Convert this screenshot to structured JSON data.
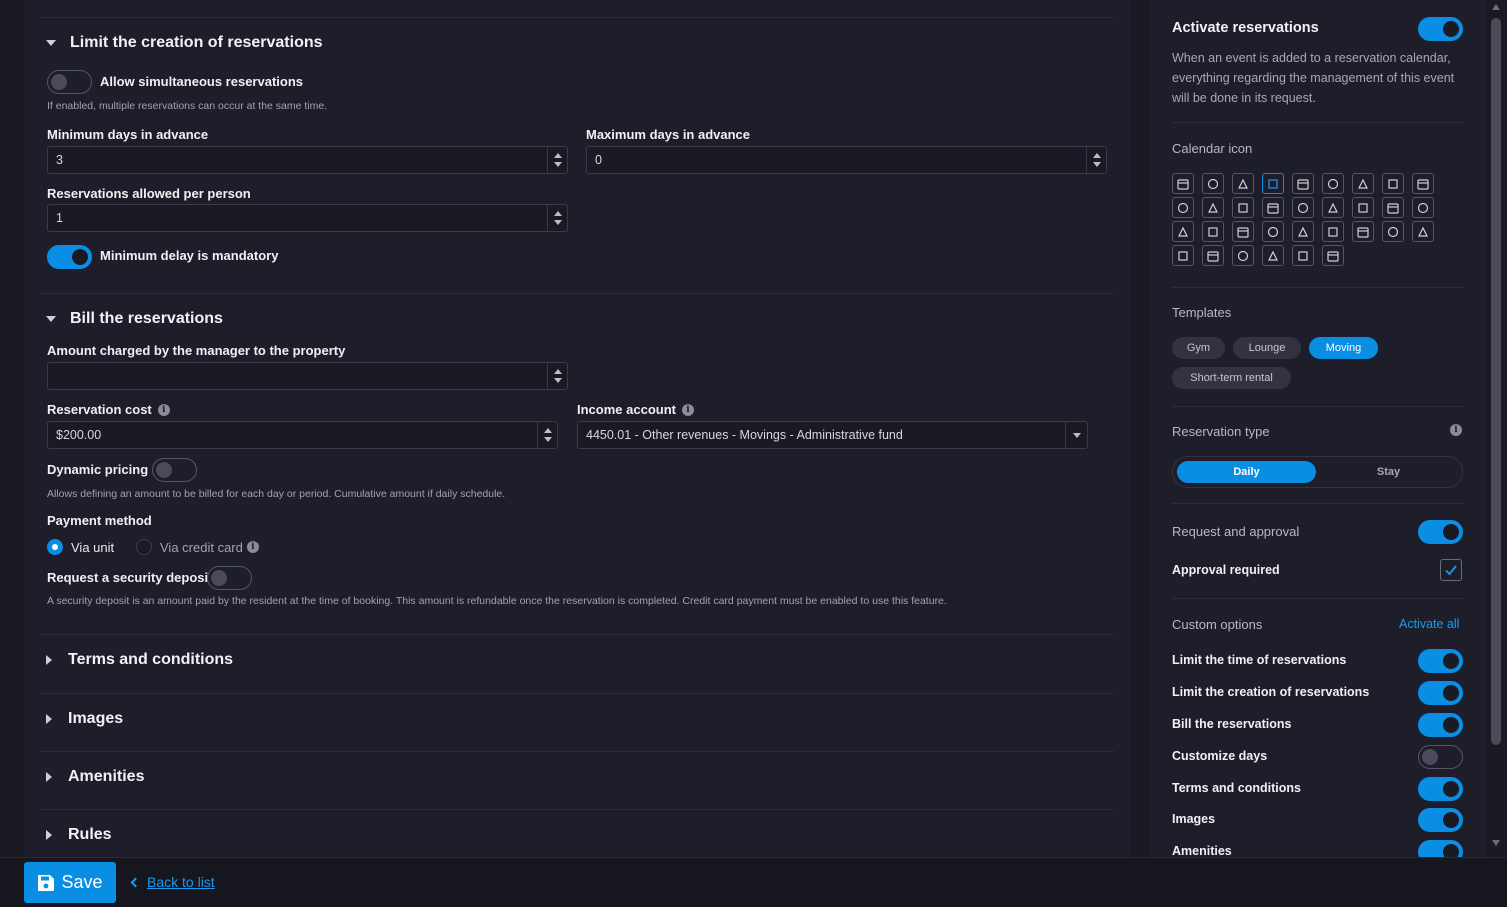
{
  "main": {
    "limit_section": {
      "title": "Limit the creation of reservations",
      "simultaneous": {
        "label": "Allow simultaneous reservations",
        "help": "If enabled, multiple reservations can occur at the same time.",
        "on": false
      },
      "min_days": {
        "label": "Minimum days in advance",
        "value": "3"
      },
      "max_days": {
        "label": "Maximum days in advance",
        "value": "0"
      },
      "per_person": {
        "label": "Reservations allowed per person",
        "value": "1"
      },
      "min_delay": {
        "label": "Minimum delay is mandatory",
        "on": true
      }
    },
    "bill_section": {
      "title": "Bill the reservations",
      "amount_charged": {
        "label": "Amount charged by the manager to the property",
        "value": ""
      },
      "reservation_cost": {
        "label": "Reservation cost",
        "value": "$200.00"
      },
      "income_account": {
        "label": "Income account",
        "value": "4450.01 - Other revenues - Movings - Administrative fund"
      },
      "dynamic_pricing": {
        "label": "Dynamic pricing",
        "help": "Allows defining an amount to be billed for each day or period. Cumulative amount if daily schedule.",
        "on": false
      },
      "payment_method": {
        "label": "Payment method",
        "options": [
          "Via unit",
          "Via credit card"
        ],
        "selected": "Via unit"
      },
      "security_deposit": {
        "label": "Request a security deposit",
        "help": "A security deposit is an amount paid by the resident at the time of booking. This amount is refundable once the reservation is completed. Credit card payment must be enabled to use this feature.",
        "on": false
      }
    },
    "collapsed_sections": [
      "Terms and conditions",
      "Images",
      "Amenities",
      "Rules"
    ]
  },
  "sidebar": {
    "activate": {
      "title": "Activate reservations",
      "on": true,
      "description": "When an event is added to a reservation calendar, everything regarding the management of this event will be done in its request."
    },
    "calendar_icon": {
      "label": "Calendar icon",
      "selected_index": 3
    },
    "templates": {
      "label": "Templates",
      "items": [
        "Gym",
        "Lounge",
        "Moving",
        "Short-term rental"
      ],
      "selected": "Moving"
    },
    "reservation_type": {
      "label": "Reservation type",
      "options": [
        "Daily",
        "Stay"
      ],
      "selected": "Daily"
    },
    "request_approval": {
      "label": "Request and approval",
      "on": true
    },
    "approval_required": {
      "label": "Approval required",
      "checked": true
    },
    "custom_options": {
      "label": "Custom options",
      "activate_all": "Activate all",
      "items": [
        {
          "label": "Limit the time of reservations",
          "on": true
        },
        {
          "label": "Limit the creation of reservations",
          "on": true
        },
        {
          "label": "Bill the reservations",
          "on": true
        },
        {
          "label": "Customize days",
          "on": false
        },
        {
          "label": "Terms and conditions",
          "on": true
        },
        {
          "label": "Images",
          "on": true
        },
        {
          "label": "Amenities",
          "on": true
        }
      ]
    }
  },
  "footer": {
    "save_label": "Save",
    "back_label": "Back to list"
  },
  "colors": {
    "accent": "#0a8ee4",
    "background": "#1e1e2a",
    "link": "#1a9aef"
  }
}
